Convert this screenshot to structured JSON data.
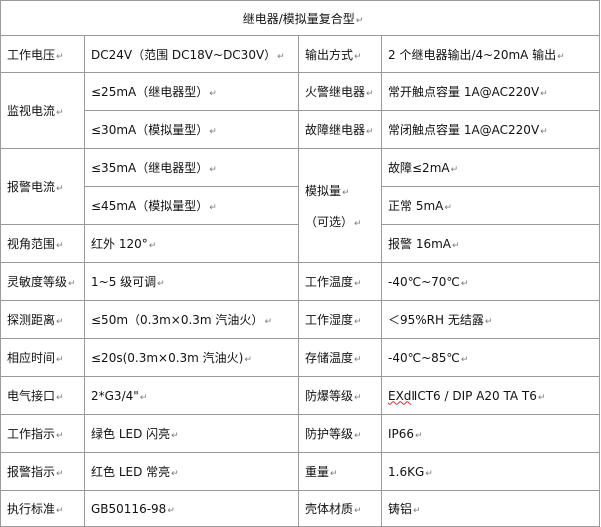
{
  "title": "继电器/模拟量复合型",
  "para_mark": "↵",
  "rows": {
    "voltage": {
      "label": "工作电压",
      "value": "DC24V（范围 DC18V~DC30V）",
      "label2": "输出方式",
      "value2": "2 个继电器输出/4~20mA 输出"
    },
    "monitor": {
      "label": "监视电流",
      "value_a": "≤25mA（继电器型）",
      "value_b": "≤30mA（模拟量型）",
      "label2_a": "火警继电器",
      "value2_a": "常开触点容量 1A@AC220V",
      "label2_b": "故障继电器",
      "value2_b": "常闭触点容量 1A@AC220V"
    },
    "alarm": {
      "label": "报警电流",
      "value_a": "≤35mA（继电器型）",
      "value_b": "≤45mA（模拟量型）"
    },
    "analog": {
      "label": "模拟量",
      "label_sub": "（可选）",
      "fault": "故障≤2mA",
      "normal": "正常 5mA",
      "alarm": "报警 16mA"
    },
    "view": {
      "label": "视角范围",
      "value": "红外 120°"
    },
    "sensitivity": {
      "label": "灵敏度等级",
      "value": "1~5 级可调",
      "label2": "工作温度",
      "value2": "-40℃~70℃"
    },
    "distance": {
      "label": "探测距离",
      "value": "≤50m（0.3m×0.3m 汽油火）",
      "label2": "工作湿度",
      "value2": "＜95%RH 无结露"
    },
    "response": {
      "label": "相应时间",
      "value": "≤20s(0.3m×0.3m 汽油火)",
      "label2": "存储温度",
      "value2": "-40℃~85℃"
    },
    "interface": {
      "label": "电气接口",
      "value": "2*G3/4\"",
      "label2": "防爆等级",
      "value2_ex": "EXd",
      "value2": "ⅡCT6 / DIP A20 TA T6"
    },
    "indicator": {
      "label": "工作指示",
      "value": "绿色 LED 闪亮",
      "label2": "防护等级",
      "value2": "IP66"
    },
    "alarm_ind": {
      "label": "报警指示",
      "value": "红色 LED 常亮",
      "label2": "重量",
      "value2": "1.6KG"
    },
    "standard": {
      "label": "执行标准",
      "value": "GB50116-98",
      "label2": "壳体材质",
      "value2": "铸铝"
    }
  }
}
